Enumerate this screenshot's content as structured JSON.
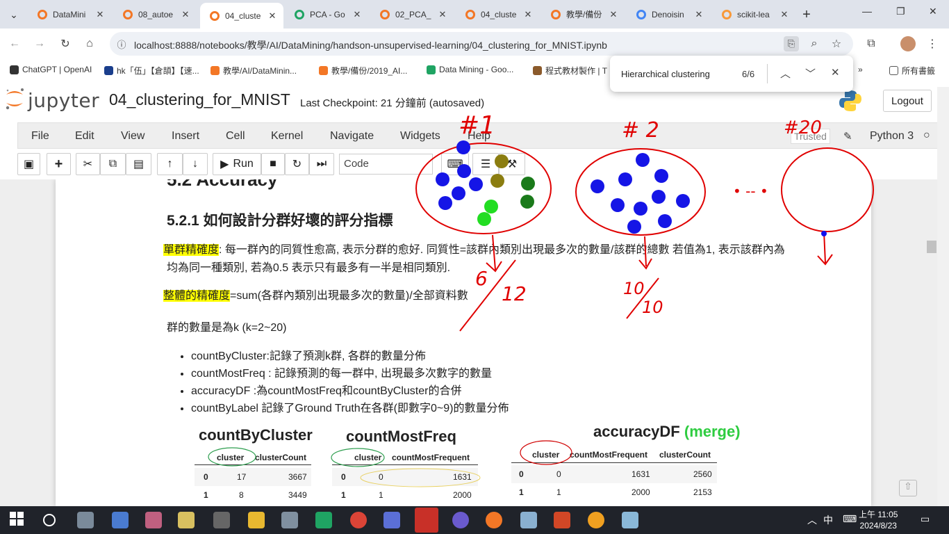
{
  "browser": {
    "tabs": [
      {
        "label": "DataMini",
        "color": "#f37726"
      },
      {
        "label": "08_autoe",
        "color": "#f37726"
      },
      {
        "label": "04_cluste",
        "color": "#f37726",
        "active": true
      },
      {
        "label": "PCA - Go",
        "color": "#1fa463"
      },
      {
        "label": "02_PCA_",
        "color": "#f37726"
      },
      {
        "label": "04_cluste",
        "color": "#f37726"
      },
      {
        "label": "教學/備份",
        "color": "#f37726"
      },
      {
        "label": "Denoisin",
        "color": "#4285f4"
      },
      {
        "label": "scikit-lea",
        "color": "#f89939"
      }
    ],
    "url": "localhost:8888/notebooks/教學/AI/DataMining/handson-unsupervised-learning/04_clustering_for_MNIST.ipynb",
    "bookmarks": [
      {
        "label": "ChatGPT | OpenAI",
        "color": "#333333"
      },
      {
        "label": "hk「伍」【倉頡】【速...",
        "color": "#1a3e8c"
      },
      {
        "label": "教學/AI/DataMinin...",
        "color": "#f37726"
      },
      {
        "label": "教學/備份/2019_AI...",
        "color": "#f37726"
      },
      {
        "label": "Data Mining - Goo...",
        "color": "#1fa463"
      },
      {
        "label": "程式教材製作 | T",
        "color": "#8b5a2b"
      }
    ],
    "all_bookmarks": "所有書籤",
    "find": {
      "query": "Hierarchical clustering",
      "count": "6/6"
    }
  },
  "jupyter": {
    "logo_text": "jupyter",
    "notebook_name": "04_clustering_for_MNIST",
    "checkpoint": "Last Checkpoint: 21 分鐘前   (autosaved)",
    "logout": "Logout",
    "menus": [
      "File",
      "Edit",
      "View",
      "Insert",
      "Cell",
      "Kernel",
      "Navigate",
      "Widgets",
      "Help"
    ],
    "trusted": "Trusted",
    "kernel": "Python 3",
    "run_label": "Run",
    "cell_type": "Code"
  },
  "content": {
    "section_heading": "5.2  Accuracy",
    "subsection_heading": "5.2.1  如何設計分群好壞的評分指標",
    "p1_highlight": "單群精確度",
    "p1_text": ": 每一群內的同質性愈高, 表示分群的愈好. 同質性=該群內類別出現最多次的數量/該群的總數 若值為1, 表示該群內為",
    "p1_text2": "均為同一種類別, 若為0.5 表示只有最多有一半是相同類別.",
    "p2_highlight": "整體的精確度",
    "p2_text": "=sum(各群內類別出現最多次的數量)/全部資料數",
    "p3_text": "群的數量是為k (k=2~20)",
    "bullets": [
      "countByCluster:記錄了預測k群, 各群的數量分佈",
      "countMostFreq : 記錄預測的每一群中, 出現最多次數字的數量",
      "accuracyDF :為countMostFreq和countByCluster的合併",
      "countByLabel 記錄了Ground Truth在各群(即數字0~9)的數量分佈"
    ],
    "tables": {
      "countByCluster": {
        "title": "countByCluster",
        "headers": [
          "cluster",
          "clusterCount"
        ],
        "rows": [
          [
            "0",
            "17",
            "3667"
          ],
          [
            "1",
            "8",
            "3449"
          ]
        ]
      },
      "countMostFreq": {
        "title": "countMostFreq",
        "headers": [
          "cluster",
          "countMostFrequent"
        ],
        "rows": [
          [
            "0",
            "0",
            "1631"
          ],
          [
            "1",
            "1",
            "2000"
          ]
        ]
      },
      "accuracyDF": {
        "title": "accuracyDF",
        "title_suffix": "(merge)",
        "headers": [
          "cluster",
          "countMostFrequent",
          "clusterCount"
        ],
        "rows": [
          [
            "0",
            "0",
            "1631",
            "2560"
          ],
          [
            "1",
            "1",
            "2000",
            "2153"
          ]
        ]
      }
    }
  },
  "annotations": {
    "cluster1_label": "#1",
    "cluster2_label": "# 2",
    "cluster20_label": "#20",
    "frac1_num": "6",
    "frac1_den": "12",
    "frac2_num": "10",
    "frac2_den": "10",
    "dots": "• -- •"
  },
  "taskbar": {
    "time": "上午 11:05",
    "date": "2024/8/23",
    "ime": "中"
  }
}
